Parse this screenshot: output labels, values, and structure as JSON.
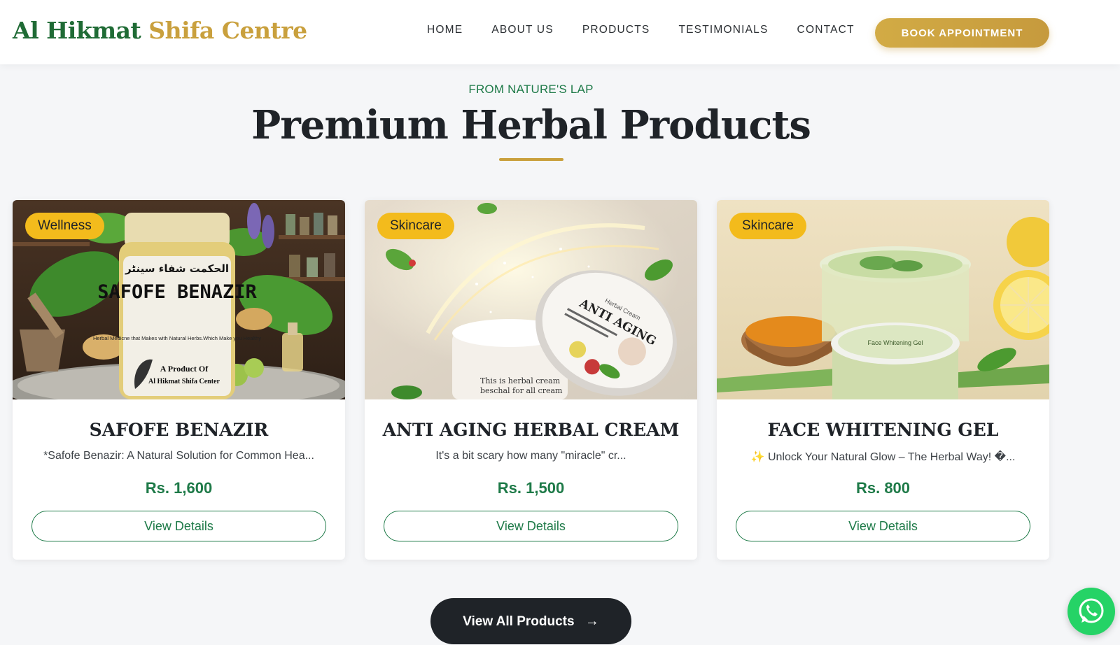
{
  "header": {
    "logo_part1": "Al Hikmat",
    "logo_part2": "Shifa Centre",
    "nav": [
      "HOME",
      "ABOUT US",
      "PRODUCTS",
      "TESTIMONIALS",
      "CONTACT"
    ],
    "book_label": "BOOK APPOINTMENT"
  },
  "section": {
    "eyebrow": "FROM NATURE'S LAP",
    "title": "Premium Herbal Products"
  },
  "products": [
    {
      "badge": "Wellness",
      "name": "SAFOFE BENAZIR",
      "description": "*Safofe Benazir: A Natural Solution for Common Hea...",
      "price": "Rs. 1,600",
      "button": "View Details",
      "jar_label_urdu": "الحکمت شفاء سینٹر",
      "jar_label": "SAFOFE BENAZIR",
      "jar_text": "Herbal Medicne that Makes with Natural Herbs.Which Make you Healthy",
      "jar_maker1": "A Product Of",
      "jar_maker2": "Al Hikmat Shifa Center"
    },
    {
      "badge": "Skincare",
      "name": "ANTI AGING HERBAL CREAM",
      "description": "It's a bit scary how many \"miracle\" cr...",
      "price": "Rs. 1,500",
      "button": "View Details",
      "lid_small": "Herbal Cream",
      "lid_title": "ANTI AGING",
      "jar_text1": "This is herbal cream",
      "jar_text2": "beschal for all cream"
    },
    {
      "badge": "Skincare",
      "name": "FACE WHITENING GEL",
      "description": "✨ Unlock Your Natural Glow – The Herbal Way! �...",
      "price": "Rs. 800",
      "button": "View Details",
      "lid_label": "Face Whitening Gel"
    }
  ],
  "view_all_label": "View All Products",
  "icons": {
    "arrow": "arrow-right-icon",
    "whatsapp": "whatsapp-icon"
  },
  "colors": {
    "green": "#1e7a48",
    "gold": "#c9a03d",
    "badge": "#f3bb1c",
    "dark": "#1f2328",
    "whatsapp": "#25d366"
  }
}
